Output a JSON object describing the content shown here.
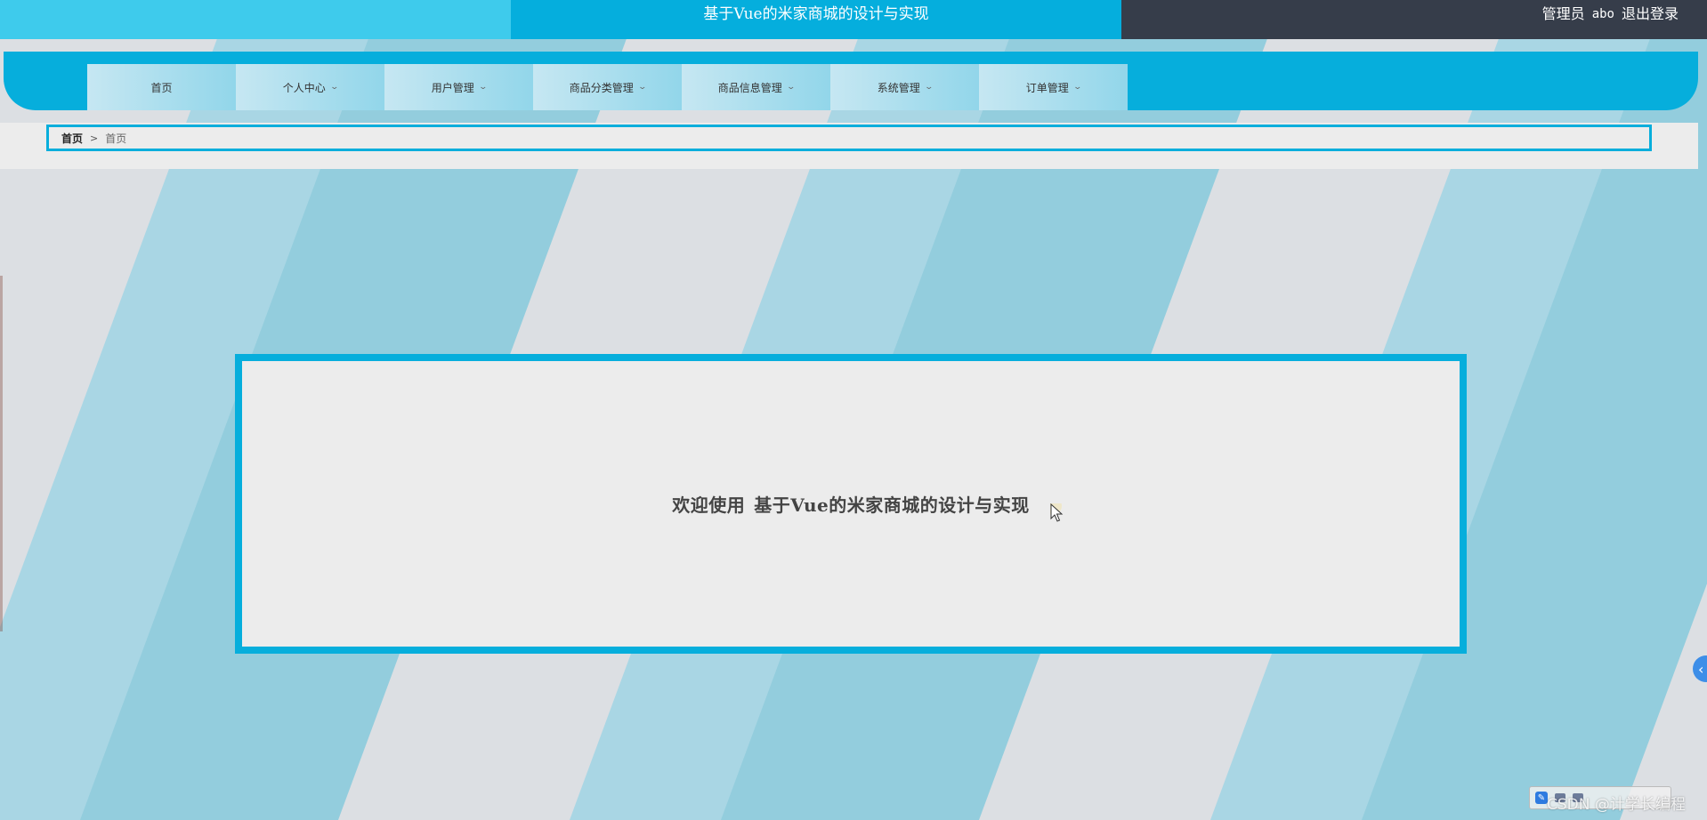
{
  "header": {
    "title": "基于Vue的米家商城的设计与实现",
    "role_label": "管理员",
    "username": "abo",
    "logout_label": "退出登录"
  },
  "nav": {
    "items": [
      {
        "label": "首页",
        "has_dropdown": false
      },
      {
        "label": "个人中心",
        "has_dropdown": true
      },
      {
        "label": "用户管理",
        "has_dropdown": true
      },
      {
        "label": "商品分类管理",
        "has_dropdown": true
      },
      {
        "label": "商品信息管理",
        "has_dropdown": true
      },
      {
        "label": "系统管理",
        "has_dropdown": true
      },
      {
        "label": "订单管理",
        "has_dropdown": true
      }
    ]
  },
  "breadcrumb": {
    "home": "首页",
    "current": "首页"
  },
  "welcome": {
    "prefix": "欢迎使用",
    "title": "基于Vue的米家商城的设计与实现"
  },
  "watermark": "CSDN @计学长编程",
  "icons": {
    "dropdown": "chevron-down-icon",
    "separator": "chevron-right-icon",
    "side_toggle": "chevron-left-icon",
    "cursor": "mouse-pointer-icon"
  },
  "colors": {
    "primary": "#06aedc",
    "accent_light": "#3ecbec",
    "header_dark": "#363d4a",
    "stripe_light": "#a9d6e4",
    "stripe_mid": "#93cddd",
    "background": "#dcdfe3"
  }
}
